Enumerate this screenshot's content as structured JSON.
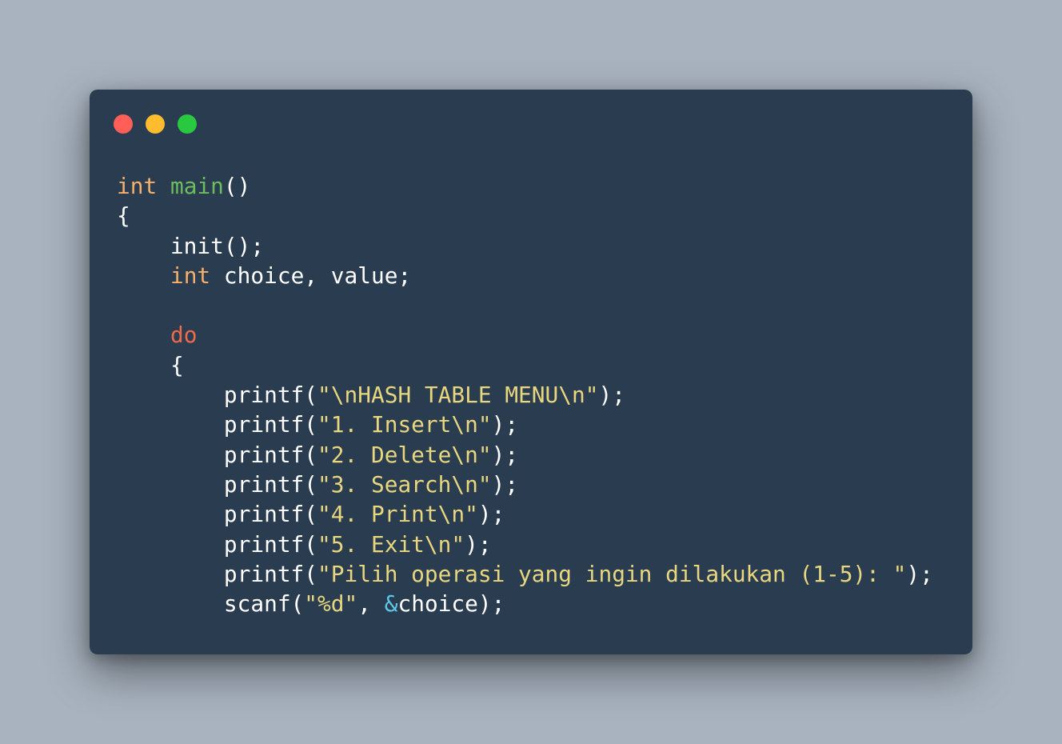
{
  "colors": {
    "background": "#a8b3bf",
    "window_bg": "#2a3c4f",
    "close": "#ff5f57",
    "minimize": "#febc2e",
    "maximize": "#28c840",
    "plain": "#ffffff",
    "type": "#f6b06b",
    "function": "#6cbd5e",
    "keyword": "#ef6a4c",
    "string": "#e8d77f",
    "operator": "#5fc8e8"
  },
  "window_controls": [
    {
      "name": "close-button",
      "color": "#ff5f57"
    },
    {
      "name": "minimize-button",
      "color": "#febc2e"
    },
    {
      "name": "maximize-button",
      "color": "#28c840"
    }
  ],
  "code_lines": [
    [
      {
        "t": "int",
        "k": "type"
      },
      {
        "t": " "
      },
      {
        "t": "main",
        "k": "function"
      },
      {
        "t": "()"
      }
    ],
    [
      {
        "t": "{"
      }
    ],
    [
      {
        "t": "    init();"
      }
    ],
    [
      {
        "t": "    "
      },
      {
        "t": "int",
        "k": "type"
      },
      {
        "t": " choice, value;"
      }
    ],
    [],
    [
      {
        "t": "    "
      },
      {
        "t": "do",
        "k": "keyword"
      }
    ],
    [
      {
        "t": "    {"
      }
    ],
    [
      {
        "t": "        printf("
      },
      {
        "t": "\"\\nHASH TABLE MENU\\n\"",
        "k": "string"
      },
      {
        "t": ");"
      }
    ],
    [
      {
        "t": "        printf("
      },
      {
        "t": "\"1. Insert\\n\"",
        "k": "string"
      },
      {
        "t": ");"
      }
    ],
    [
      {
        "t": "        printf("
      },
      {
        "t": "\"2. Delete\\n\"",
        "k": "string"
      },
      {
        "t": ");"
      }
    ],
    [
      {
        "t": "        printf("
      },
      {
        "t": "\"3. Search\\n\"",
        "k": "string"
      },
      {
        "t": ");"
      }
    ],
    [
      {
        "t": "        printf("
      },
      {
        "t": "\"4. Print\\n\"",
        "k": "string"
      },
      {
        "t": ");"
      }
    ],
    [
      {
        "t": "        printf("
      },
      {
        "t": "\"5. Exit\\n\"",
        "k": "string"
      },
      {
        "t": ");"
      }
    ],
    [
      {
        "t": "        printf("
      },
      {
        "t": "\"Pilih operasi yang ingin dilakukan (1-5): \"",
        "k": "string"
      },
      {
        "t": ");"
      }
    ],
    [
      {
        "t": "        scanf("
      },
      {
        "t": "\"%d\"",
        "k": "string"
      },
      {
        "t": ", "
      },
      {
        "t": "&",
        "k": "operator"
      },
      {
        "t": "choice);"
      }
    ]
  ]
}
